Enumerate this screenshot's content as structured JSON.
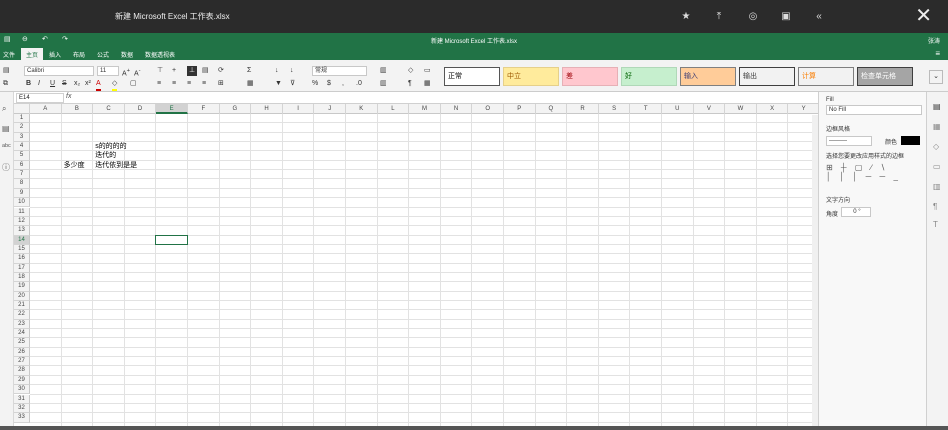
{
  "window": {
    "title": "新建 Microsoft Excel 工作表.xlsx",
    "close": "✕",
    "toolbar_icons": [
      "star-icon",
      "pin-top-icon",
      "chrome-icon",
      "delete-icon",
      "collapse-icon"
    ]
  },
  "titlebar": {
    "title": "新建 Microsoft Excel 工作表.xlsx",
    "user": "张涛"
  },
  "menu": {
    "file": "文件",
    "home": "主页",
    "insert": "插入",
    "layout": "布局",
    "formula": "公式",
    "data": "数据",
    "pivot": "数据透视表"
  },
  "ribbon": {
    "font": "Calibri",
    "size": "11",
    "format": "常规"
  },
  "styles": [
    {
      "label": "正常",
      "bg": "#ffffff",
      "color": "#000000",
      "border": "#555555"
    },
    {
      "label": "中立",
      "bg": "#ffeb9c",
      "color": "#9c5700",
      "border": "#e6d08a"
    },
    {
      "label": "差",
      "bg": "#ffc7ce",
      "color": "#9c0006",
      "border": "#e6b0b6"
    },
    {
      "label": "好",
      "bg": "#c6efce",
      "color": "#006100",
      "border": "#b0d8b8"
    },
    {
      "label": "输入",
      "bg": "#ffcc99",
      "color": "#3f3f76",
      "border": "#7f7f7f"
    },
    {
      "label": "输出",
      "bg": "#f2f2f2",
      "color": "#3f3f3f",
      "border": "#3f3f3f"
    },
    {
      "label": "计算",
      "bg": "#f2f2f2",
      "color": "#fa7d00",
      "border": "#7f7f7f"
    },
    {
      "label": "检查单元格",
      "bg": "#a5a5a5",
      "color": "#ffffff",
      "border": "#3f3f3f"
    }
  ],
  "formula": {
    "namebox": "E14",
    "fx": "fx",
    "value": ""
  },
  "columns": [
    "A",
    "B",
    "C",
    "D",
    "E",
    "F",
    "G",
    "H",
    "I",
    "J",
    "K",
    "L",
    "M",
    "N",
    "O",
    "P",
    "Q",
    "R",
    "S",
    "T",
    "U",
    "V",
    "W",
    "X",
    "Y"
  ],
  "selected_col": "E",
  "selected_row": 14,
  "rows": [
    "1",
    "2",
    "3",
    "4",
    "5",
    "6",
    "7",
    "8",
    "9",
    "10",
    "11",
    "12",
    "13",
    "14",
    "15",
    "16",
    "17",
    "18",
    "19",
    "20",
    "21",
    "22",
    "23",
    "24",
    "25",
    "26",
    "27",
    "28",
    "29",
    "30",
    "31",
    "32",
    "33"
  ],
  "cells": {
    "C4": "s的的的的",
    "C5": "迭代的",
    "C6": "迭代依到是是",
    "B6": "多少度"
  },
  "panel": {
    "fill_label": "Fill",
    "fill_value": "No Fill",
    "border_style": "边框风格",
    "color_label": "颜色",
    "border_hint": "选择您要更改应用样式的边框",
    "text_dir": "文字方向",
    "angle_label": "角度",
    "angle_value": "0 °"
  },
  "colors": {
    "accent": "#217346",
    "dark": "#2b2b2b"
  }
}
